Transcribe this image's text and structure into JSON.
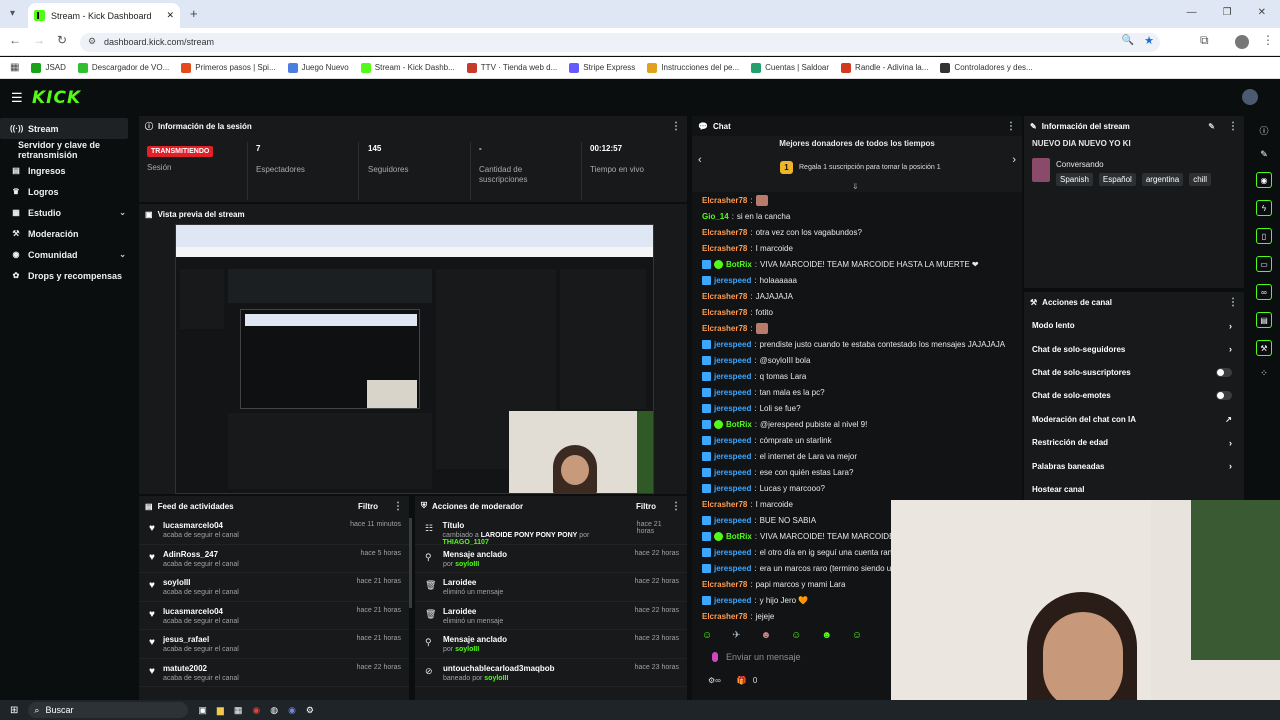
{
  "browser": {
    "tab_title": "Stream - Kick Dashboard",
    "url": "dashboard.kick.com/stream",
    "bookmarks": [
      {
        "label": "JSAD",
        "color": "#1aa31a"
      },
      {
        "label": "Descargador de VO...",
        "color": "#2fbf2f"
      },
      {
        "label": "Primeros pasos | Spi...",
        "color": "#e24a1c"
      },
      {
        "label": "Juego Nuevo",
        "color": "#4a7fe0"
      },
      {
        "label": "Stream - Kick Dashb...",
        "color": "#53fc18"
      },
      {
        "label": "TTV · Tienda web d...",
        "color": "#c83a2a"
      },
      {
        "label": "Stripe Express",
        "color": "#635bff"
      },
      {
        "label": "Instrucciones del pe...",
        "color": "#e0a21c"
      },
      {
        "label": "Cuentas | Saldoar",
        "color": "#23a06b"
      },
      {
        "label": "Randle - Adivina la...",
        "color": "#d13a1f"
      },
      {
        "label": "Controladores y des...",
        "color": "#333333"
      }
    ]
  },
  "app": {
    "logo": "KICK",
    "nav": [
      {
        "label": "Stream",
        "icon": "radio-icon",
        "active": true
      },
      {
        "label": "Servidor y clave de retransmisión",
        "icon": "",
        "active": false
      },
      {
        "label": "Ingresos",
        "icon": "money-icon",
        "active": false
      },
      {
        "label": "Logros",
        "icon": "trophy-icon",
        "active": false
      },
      {
        "label": "Estudio",
        "icon": "studio-icon",
        "active": false,
        "chev": "⌄"
      },
      {
        "label": "Moderación",
        "icon": "hammer-icon",
        "active": false
      },
      {
        "label": "Comunidad",
        "icon": "community-icon",
        "active": false,
        "chev": "⌄"
      },
      {
        "label": "Drops y recompensas",
        "icon": "gift-icon",
        "active": false
      }
    ]
  },
  "session": {
    "title": "Información de la sesión",
    "status_badge": "TRANSMITIENDO",
    "status_label": "Sesión",
    "viewers": "7",
    "viewers_label": "Espectadores",
    "followers": "145",
    "followers_label": "Seguidores",
    "subs": "-",
    "subs_label": "Cantidad de suscripciones",
    "live": "00:12:57",
    "live_label": "Tiempo en vivo"
  },
  "preview": {
    "title": "Vista previa del stream"
  },
  "feed": {
    "title": "Feed de actividades",
    "filter": "Filtro",
    "items": [
      {
        "name": "lucasmarcelo04",
        "sub": "acaba de seguir el canal",
        "time": "hace 11 minutos"
      },
      {
        "name": "AdinRoss_247",
        "sub": "acaba de seguir el canal",
        "time": "hace 5 horas"
      },
      {
        "name": "soyloIII",
        "sub": "acaba de seguir el canal",
        "time": "hace 21 horas"
      },
      {
        "name": "lucasmarcelo04",
        "sub": "acaba de seguir el canal",
        "time": "hace 21 horas"
      },
      {
        "name": "jesus_rafael",
        "sub": "acaba de seguir el canal",
        "time": "hace 21 horas"
      },
      {
        "name": "matute2002",
        "sub": "acaba de seguir el canal",
        "time": "hace 22 horas"
      }
    ]
  },
  "modactions": {
    "title": "Acciones de moderador",
    "filter": "Filtro",
    "items": [
      {
        "icon": "title-icon",
        "title": "Título",
        "sub_pre": "cambiado a",
        "sub_mid": "LAROIDE PONY PONY PONY",
        "sub_mid2": "por",
        "sub_user": "THIAGO_1107",
        "time": "hace 21 horas"
      },
      {
        "icon": "pin-icon",
        "title": "Mensaje anclado",
        "sub_pre": "por",
        "sub_mid": "",
        "sub_mid2": "",
        "sub_user": "soyloIII",
        "time": "hace 22 horas"
      },
      {
        "icon": "trash-icon",
        "title": "Laroidee",
        "sub_pre": "eliminó un mensaje",
        "sub_mid": "",
        "sub_mid2": "",
        "sub_user": "",
        "time": "hace 22 horas"
      },
      {
        "icon": "trash-icon",
        "title": "Laroidee",
        "sub_pre": "eliminó un mensaje",
        "sub_mid": "",
        "sub_mid2": "",
        "sub_user": "",
        "time": "hace 22 horas"
      },
      {
        "icon": "pin-icon",
        "title": "Mensaje anclado",
        "sub_pre": "por",
        "sub_mid": "",
        "sub_mid2": "",
        "sub_user": "soyloIII",
        "time": "hace 23 horas"
      },
      {
        "icon": "ban-icon",
        "title": "untouchablecarload3maqbob",
        "sub_pre": "baneado por",
        "sub_mid": "",
        "sub_mid2": "",
        "sub_user": "soyloIII",
        "time": "hace 23 horas"
      }
    ]
  },
  "chat": {
    "title": "Chat",
    "donors_title": "Mejores donadores de todos los tiempos",
    "donors_text": "Regala 1 suscripción para tomar la posición 1",
    "input_placeholder": "Enviar un mensaje",
    "footer_count": "0",
    "messages": [
      {
        "user": "Elcrasher78",
        "color": "u1",
        "badge": "",
        "text": ""
      },
      {
        "user": "Gio_14",
        "color": "u2",
        "badge": "",
        "text": "si en la cancha"
      },
      {
        "user": "Elcrasher78",
        "color": "u1",
        "badge": "",
        "text": "otra vez con los vagabundos?"
      },
      {
        "user": "Elcrasher78",
        "color": "u1",
        "badge": "",
        "text": "I marcoide"
      },
      {
        "user": "BotRix",
        "color": "u4",
        "badge": "bot",
        "text": "VIVA MARCOIDE! TEAM MARCOIDE HASTA LA MUERTE ❤"
      },
      {
        "user": "jerespeed",
        "color": "u3",
        "badge": "mod",
        "text": "holaaaaaa"
      },
      {
        "user": "Elcrasher78",
        "color": "u1",
        "badge": "",
        "text": "JAJAJAJA"
      },
      {
        "user": "Elcrasher78",
        "color": "u1",
        "badge": "",
        "text": "fotito"
      },
      {
        "user": "Elcrasher78",
        "color": "u1",
        "badge": "",
        "text": ""
      },
      {
        "user": "jerespeed",
        "color": "u3",
        "badge": "mod",
        "text": "prendiste justo cuando te estaba contestado los mensajes JAJAJAJA"
      },
      {
        "user": "jerespeed",
        "color": "u3",
        "badge": "mod",
        "text": "@soyloIII bola"
      },
      {
        "user": "jerespeed",
        "color": "u3",
        "badge": "mod",
        "text": "q tomas Lara"
      },
      {
        "user": "jerespeed",
        "color": "u3",
        "badge": "mod",
        "text": "tan mala es la pc?"
      },
      {
        "user": "jerespeed",
        "color": "u3",
        "badge": "mod",
        "text": "Loli se fue?"
      },
      {
        "user": "BotRix",
        "color": "u4",
        "badge": "bot",
        "text": "@jerespeed pubiste al nivel 9!"
      },
      {
        "user": "jerespeed",
        "color": "u3",
        "badge": "mod",
        "text": "cómprate un starlink"
      },
      {
        "user": "jerespeed",
        "color": "u3",
        "badge": "mod",
        "text": "el internet de Lara va mejor"
      },
      {
        "user": "jerespeed",
        "color": "u3",
        "badge": "mod",
        "text": "ese con quién estas Lara?"
      },
      {
        "user": "jerespeed",
        "color": "u3",
        "badge": "mod",
        "text": "Lucas y marcooo?"
      },
      {
        "user": "Elcrasher78",
        "color": "u1",
        "badge": "",
        "text": "I marcoide"
      },
      {
        "user": "jerespeed",
        "color": "u3",
        "badge": "mod",
        "text": "BUE NO SABIA"
      },
      {
        "user": "BotRix",
        "color": "u4",
        "badge": "bot",
        "text": "VIVA MARCOIDE! TEAM MARCOIDE HASTA"
      },
      {
        "user": "jerespeed",
        "color": "u3",
        "badge": "mod",
        "text": "el otro día en ig seguí una cuenta random p"
      },
      {
        "user": "jerespeed",
        "color": "u3",
        "badge": "mod",
        "text": "era un marcos raro (termino siendo un ami"
      },
      {
        "user": "Elcrasher78",
        "color": "u1",
        "badge": "",
        "text": "papi marcos y mami Lara"
      },
      {
        "user": "jerespeed",
        "color": "u3",
        "badge": "mod",
        "text": "y hijo Jero 🧡"
      },
      {
        "user": "Elcrasher78",
        "color": "u1",
        "badge": "",
        "text": "jejeje"
      }
    ]
  },
  "streaminfo": {
    "title": "Información del stream",
    "stream_title": "NUEVO DIA NUEVO YO KI",
    "category": "Conversando",
    "tags": [
      "Spanish",
      "Español",
      "argentina",
      "chill"
    ]
  },
  "channel": {
    "title": "Acciones de canal",
    "actions": [
      {
        "label": "Modo lento",
        "control": "chevron"
      },
      {
        "label": "Chat de solo-seguidores",
        "control": "chevron"
      },
      {
        "label": "Chat de solo-suscriptores",
        "control": "toggle"
      },
      {
        "label": "Chat de solo-emotes",
        "control": "toggle"
      },
      {
        "label": "Moderación del chat con IA",
        "control": "external"
      },
      {
        "label": "Restricción de edad",
        "control": "chevron"
      },
      {
        "label": "Palabras baneadas",
        "control": "chevron"
      },
      {
        "label": "Hostear canal",
        "control": "none"
      }
    ]
  },
  "taskbar": {
    "search": "Buscar"
  }
}
